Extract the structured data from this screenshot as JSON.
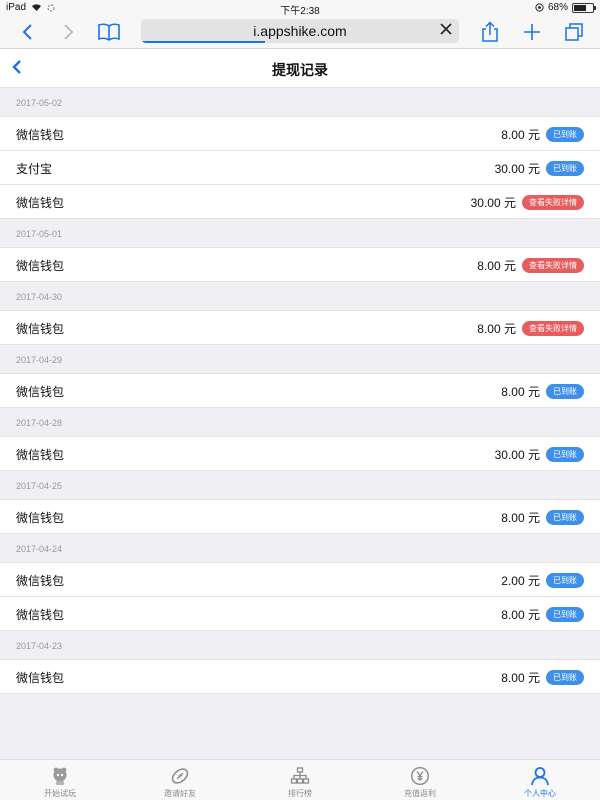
{
  "status": {
    "device": "iPad",
    "time": "下午2:38",
    "battery": "68%",
    "battery_level": 0.68
  },
  "browser": {
    "url": "i.appshike.com",
    "load_progress": 0.39
  },
  "nav": {
    "title": "提现记录"
  },
  "records": [
    {
      "date": "2017-05-02",
      "items": [
        {
          "method": "微信钱包",
          "amount": "8.00",
          "unit": "元",
          "status": "已到账",
          "status_type": "ok"
        },
        {
          "method": "支付宝",
          "amount": "30.00",
          "unit": "元",
          "status": "已到账",
          "status_type": "ok"
        },
        {
          "method": "微信钱包",
          "amount": "30.00",
          "unit": "元",
          "status": "查看失败详情",
          "status_type": "fail"
        }
      ]
    },
    {
      "date": "2017-05-01",
      "items": [
        {
          "method": "微信钱包",
          "amount": "8.00",
          "unit": "元",
          "status": "查看失败详情",
          "status_type": "fail"
        }
      ]
    },
    {
      "date": "2017-04-30",
      "items": [
        {
          "method": "微信钱包",
          "amount": "8.00",
          "unit": "元",
          "status": "查看失败详情",
          "status_type": "fail"
        }
      ]
    },
    {
      "date": "2017-04-29",
      "items": [
        {
          "method": "微信钱包",
          "amount": "8.00",
          "unit": "元",
          "status": "已到账",
          "status_type": "ok"
        }
      ]
    },
    {
      "date": "2017-04-28",
      "items": [
        {
          "method": "微信钱包",
          "amount": "30.00",
          "unit": "元",
          "status": "已到账",
          "status_type": "ok"
        }
      ]
    },
    {
      "date": "2017-04-25",
      "items": [
        {
          "method": "微信钱包",
          "amount": "8.00",
          "unit": "元",
          "status": "已到账",
          "status_type": "ok"
        }
      ]
    },
    {
      "date": "2017-04-24",
      "items": [
        {
          "method": "微信钱包",
          "amount": "2.00",
          "unit": "元",
          "status": "已到账",
          "status_type": "ok"
        },
        {
          "method": "微信钱包",
          "amount": "8.00",
          "unit": "元",
          "status": "已到账",
          "status_type": "ok"
        }
      ]
    },
    {
      "date": "2017-04-23",
      "items": [
        {
          "method": "微信钱包",
          "amount": "8.00",
          "unit": "元",
          "status": "已到账",
          "status_type": "ok"
        }
      ]
    }
  ],
  "tabs": [
    {
      "label": "开始试玩",
      "icon": "mascot-icon",
      "active": false
    },
    {
      "label": "邀请好友",
      "icon": "rugby-ball-icon",
      "active": false
    },
    {
      "label": "排行榜",
      "icon": "org-chart-icon",
      "active": false
    },
    {
      "label": "充值返利",
      "icon": "yen-coin-icon",
      "active": false
    },
    {
      "label": "个人中心",
      "icon": "person-icon",
      "active": true
    }
  ],
  "colors": {
    "accent": "#1a73e8",
    "success_badge": "#3d8fe8",
    "fail_badge": "#e75c5c"
  }
}
